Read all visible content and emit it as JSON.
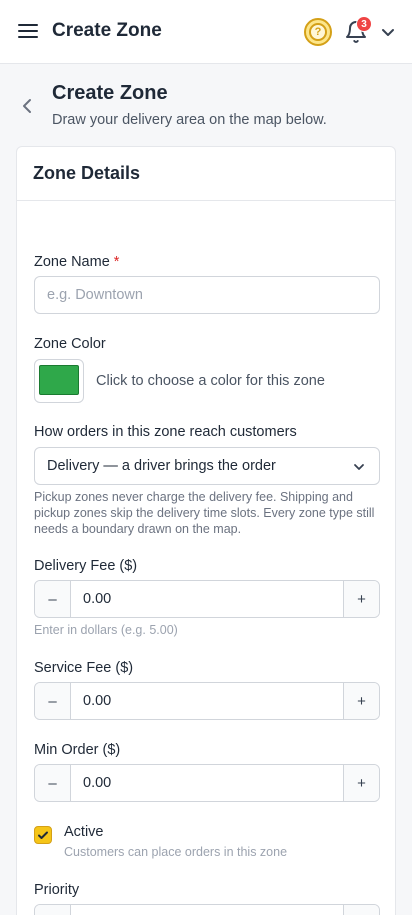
{
  "header": {
    "title": "Create Zone",
    "notification_count": "3"
  },
  "page": {
    "title": "Create Zone",
    "subtitle": "Draw your delivery area on the map below."
  },
  "card": {
    "title": "Zone Details",
    "zone_name": {
      "label": "Zone Name",
      "required_mark": "*",
      "placeholder": "e.g. Downtown",
      "value": ""
    },
    "zone_color": {
      "label": "Zone Color",
      "hint": "Click to choose a color for this zone",
      "color": "#2fa84a"
    },
    "order_type": {
      "label": "How orders in this zone reach customers",
      "selected": "Delivery — a driver brings the order",
      "help": "Pickup zones never charge the delivery fee. Shipping and pickup zones skip the delivery time slots. Every zone type still needs a boundary drawn on the map."
    },
    "delivery_fee": {
      "label": "Delivery Fee ($)",
      "value": "0.00",
      "hint": "Enter in dollars (e.g. 5.00)",
      "minus": "–",
      "plus": "+"
    },
    "service_fee": {
      "label": "Service Fee ($)",
      "value": "0.00",
      "minus": "–",
      "plus": "+"
    },
    "min_order": {
      "label": "Min Order ($)",
      "value": "0.00",
      "minus": "–",
      "plus": "+"
    },
    "active": {
      "label": "Active",
      "description": "Customers can place orders in this zone",
      "checked": true
    },
    "priority": {
      "label": "Priority",
      "minus": "–",
      "plus": "+"
    }
  },
  "colors": {
    "accent": "#f5c518",
    "badge": "#ef4444",
    "zone_color": "#2fa84a"
  }
}
